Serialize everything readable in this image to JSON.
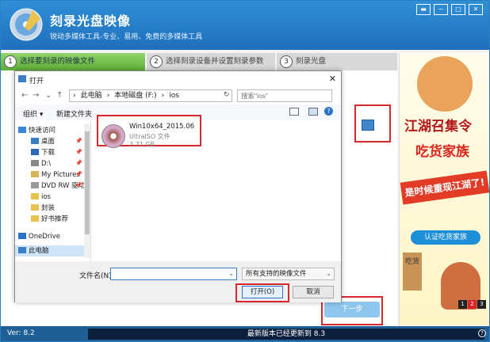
{
  "app": {
    "title": "刻录光盘映像",
    "subtitle": "锐动多媒体工具-专业、易用、免费的多媒体工具",
    "window_buttons": [
      "▬",
      "−",
      "□",
      "✕"
    ]
  },
  "steps": [
    {
      "num": "1",
      "label": "选择要刻录的映像文件"
    },
    {
      "num": "2",
      "label": "选择刻录设备并设置刻录参数"
    },
    {
      "num": "3",
      "label": "刻录光盘"
    }
  ],
  "next_label": "下一步",
  "statusbar": {
    "version": "Ver: 8.2",
    "update": "最新版本已经更新到 8.3",
    "help": "?"
  },
  "ad": {
    "line1": "江湖召集令",
    "line2": "吃货家族",
    "line3": "是时候重现江湖了!",
    "button": "认证吃货家族",
    "sign": "吃货",
    "pages": [
      "1",
      "2",
      "3"
    ],
    "active_page": "2"
  },
  "dialog": {
    "title": "打开",
    "close": "✕",
    "nav": {
      "back": "←",
      "forward": "→",
      "down": "⌄",
      "up": "↑"
    },
    "address": [
      "此电脑",
      "本地磁盘 (F:)",
      "ios"
    ],
    "address_sep": "›",
    "refresh": "↻",
    "search_placeholder": "搜索\"ios\"",
    "toolbar": {
      "organize": "组织 ▾",
      "new_folder": "新建文件夹",
      "help": "?"
    },
    "nav_items": [
      {
        "label": "快速访问",
        "icon": "star-icon",
        "color": "#3a86d6"
      },
      {
        "label": "桌面",
        "icon": "desktop-icon",
        "color": "#3a7fc4",
        "pinned": true
      },
      {
        "label": "下载",
        "icon": "download-icon",
        "color": "#2a6ab8",
        "pinned": true
      },
      {
        "label": "D:\\",
        "icon": "drive-icon",
        "color": "#888888",
        "pinned": true
      },
      {
        "label": "My Pictures",
        "icon": "pictures-icon",
        "color": "#d9b45a",
        "pinned": true
      },
      {
        "label": "DVD RW 驱动器",
        "icon": "dvd-icon",
        "color": "#999999",
        "pinned": true
      },
      {
        "label": "ios",
        "icon": "folder-icon",
        "color": "#e8c250"
      },
      {
        "label": "封装",
        "icon": "folder-icon",
        "color": "#e8c250"
      },
      {
        "label": "好书推荐",
        "icon": "folder-icon",
        "color": "#e8c250"
      },
      {
        "label": "OneDrive",
        "icon": "cloud-icon",
        "color": "#2a73c8"
      },
      {
        "label": "此电脑",
        "icon": "computer-icon",
        "color": "#3a7fc4",
        "selected": true
      }
    ],
    "pin_glyph": "📌",
    "file": {
      "name": "Win10x64_2015.06",
      "type": "UltraISO 文件",
      "size": "3.71 GB"
    },
    "filename_label": "文件名(N):",
    "filename_value": "",
    "filter_value": "所有支持的映像文件",
    "open_label": "打开(O)",
    "cancel_label": "取消"
  }
}
